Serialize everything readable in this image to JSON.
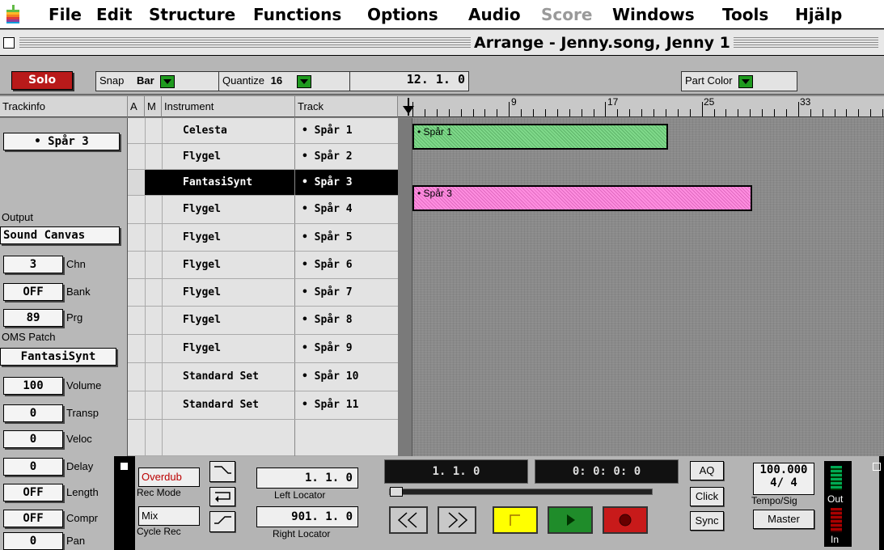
{
  "menubar": {
    "items": [
      "File",
      "Edit",
      "Structure",
      "Functions",
      "Options",
      "Audio",
      "Score",
      "Windows",
      "Tools",
      "Hjälp"
    ]
  },
  "window": {
    "title": "Arrange - Jenny.song, Jenny 1"
  },
  "toolbar": {
    "solo": "Solo",
    "snap_label": "Snap",
    "snap_value": "Bar",
    "quantize_label": "Quantize",
    "quantize_value": "16",
    "position": "12. 1. 0",
    "part_color": "Part Color"
  },
  "columns": {
    "trackinfo": "Trackinfo",
    "a": "A",
    "m": "M",
    "instrument": "Instrument",
    "track": "Track"
  },
  "ruler": {
    "labels": [
      "9",
      "17",
      "25",
      "33"
    ]
  },
  "trackinfo": {
    "selected_track": "• Spår 3",
    "output_label": "Output",
    "output_value": "Sound Canvas",
    "chn_value": "3",
    "chn_label": "Chn",
    "bank_value": "OFF",
    "bank_label": "Bank",
    "prg_value": "89",
    "prg_label": "Prg",
    "oms_label": "OMS Patch",
    "oms_value": "FantasiSynt",
    "volume_value": "100",
    "volume_label": "Volume",
    "transp_value": "0",
    "transp_label": "Transp",
    "veloc_value": "0",
    "veloc_label": "Veloc",
    "delay_value": "0",
    "delay_label": "Delay",
    "length_value": "OFF",
    "length_label": "Length",
    "compr_value": "OFF",
    "compr_label": "Compr",
    "pan_value": "0",
    "pan_label": "Pan"
  },
  "tracks": [
    {
      "instrument": "Celesta",
      "track": "• Spår 1"
    },
    {
      "instrument": "Flygel",
      "track": "• Spår 2"
    },
    {
      "instrument": "FantasiSynt",
      "track": "• Spår 3"
    },
    {
      "instrument": "Flygel",
      "track": "• Spår 4"
    },
    {
      "instrument": "Flygel",
      "track": "• Spår 5"
    },
    {
      "instrument": "Flygel",
      "track": "• Spår 6"
    },
    {
      "instrument": "Flygel",
      "track": "• Spår 7"
    },
    {
      "instrument": "Flygel",
      "track": "• Spår 8"
    },
    {
      "instrument": "Flygel",
      "track": "• Spår 9"
    },
    {
      "instrument": "Standard Set",
      "track": "• Spår 10"
    },
    {
      "instrument": "Standard Set",
      "track": "• Spår 11"
    }
  ],
  "parts": [
    {
      "label": "• Spår 1",
      "color": "#7fd98a"
    },
    {
      "label": "• Spår 3",
      "color": "#ff8ee0"
    }
  ],
  "transport": {
    "rec_mode_value": "Overdub",
    "rec_mode_label": "Rec Mode",
    "cycle_value": "Mix",
    "cycle_label": "Cycle Rec",
    "left_locator_value": "1. 1. 0",
    "left_locator_label": "Left Locator",
    "right_locator_value": "901. 1. 0",
    "right_locator_label": "Right Locator",
    "position_bars": "1. 1. 0",
    "position_smpte": "0: 0: 0: 0",
    "aq": "AQ",
    "click": "Click",
    "sync": "Sync",
    "tempo": "100.000",
    "signature": "4/ 4",
    "tempo_label": "Tempo/Sig",
    "master": "Master",
    "out_label": "Out",
    "in_label": "In"
  }
}
